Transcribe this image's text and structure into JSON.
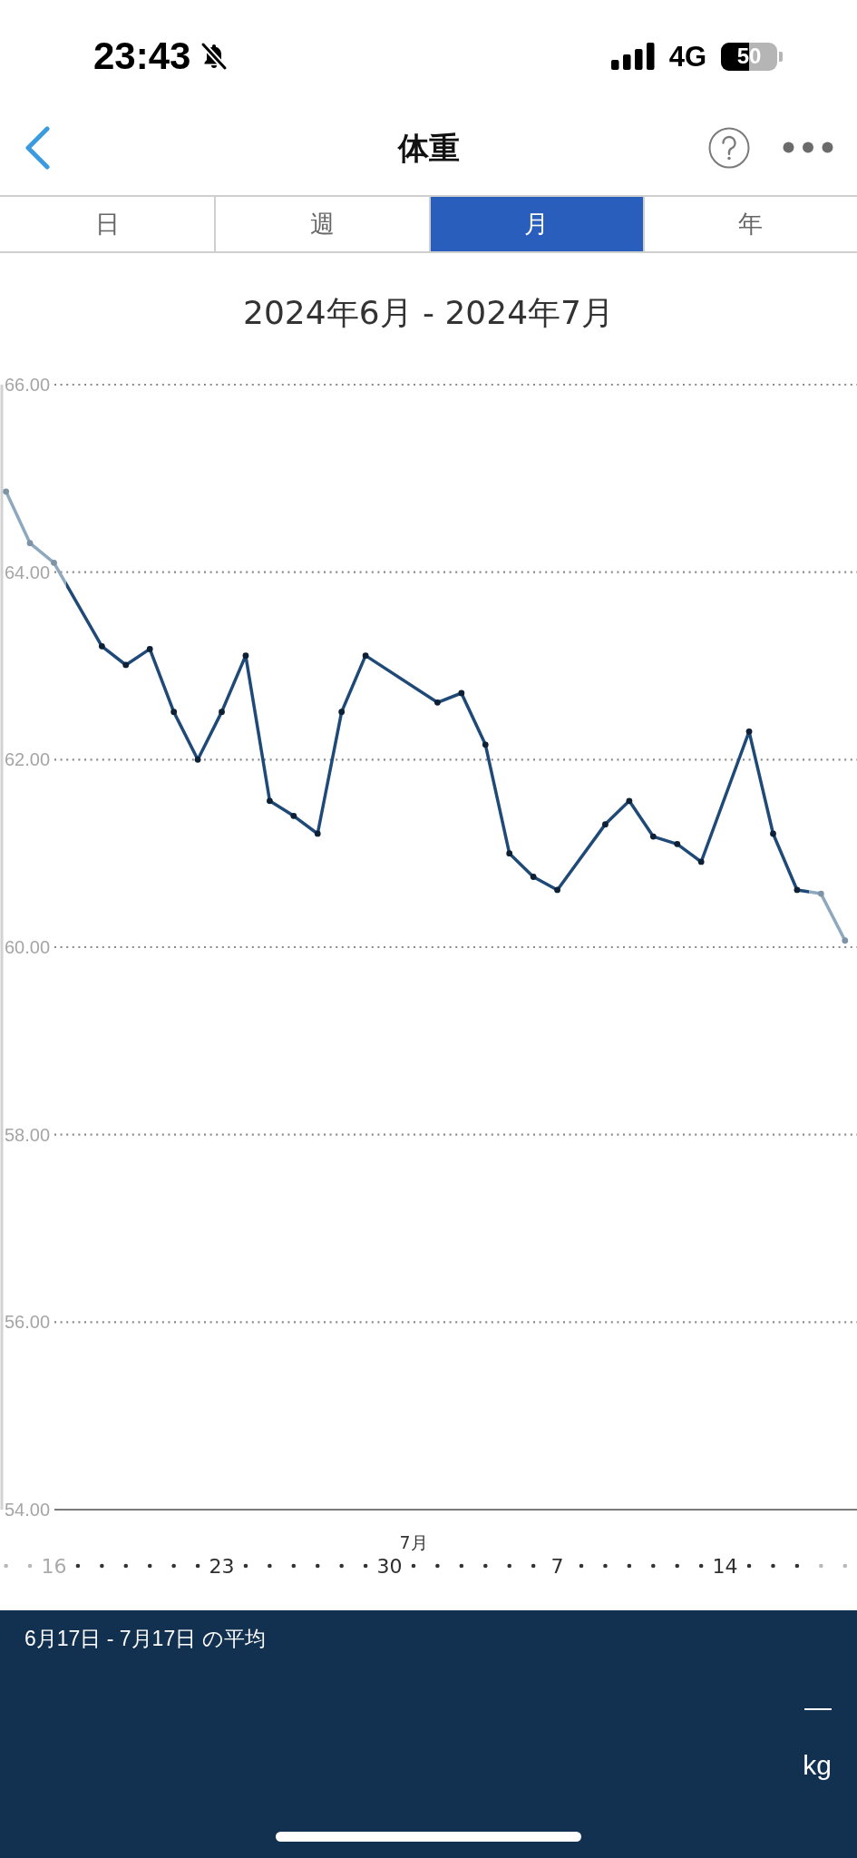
{
  "status_bar": {
    "time": "23:43",
    "network": "4G",
    "battery": "50"
  },
  "header": {
    "title": "体重"
  },
  "tabs": [
    {
      "label": "日",
      "selected": false
    },
    {
      "label": "週",
      "selected": false
    },
    {
      "label": "月",
      "selected": true
    },
    {
      "label": "年",
      "selected": false
    }
  ],
  "chart": {
    "title": "2024年6月 - 2024年7月",
    "month_labels": [
      {
        "label": "7月"
      }
    ],
    "axis_days": [
      {
        "in_period": false
      },
      {
        "in_period": false
      },
      {
        "in_period": false
      },
      {
        "in_period": true
      },
      {
        "in_period": true
      },
      {
        "in_period": true
      },
      {
        "in_period": true
      },
      {
        "in_period": true
      },
      {
        "in_period": true
      },
      {
        "in_period": true
      },
      {
        "in_period": true
      },
      {
        "in_period": true
      },
      {
        "in_period": true
      },
      {
        "in_period": true
      },
      {
        "in_period": true
      },
      {
        "in_period": true
      },
      {
        "in_period": true
      },
      {
        "in_period": true
      },
      {
        "in_period": true
      },
      {
        "in_period": true
      },
      {
        "in_period": true
      },
      {
        "in_period": true
      },
      {
        "in_period": true
      },
      {
        "in_period": true
      },
      {
        "in_period": true
      },
      {
        "in_period": true
      },
      {
        "in_period": true
      },
      {
        "in_period": true
      },
      {
        "in_period": true
      },
      {
        "in_period": true
      },
      {
        "in_period": true
      },
      {
        "in_period": true
      },
      {
        "in_period": true
      },
      {
        "in_period": true
      },
      {
        "in_period": false
      },
      {
        "in_period": false
      }
    ],
    "chart_data": {
      "type": "line",
      "grid": true,
      "x": [
        "2024-06-14",
        "2024-06-15",
        "2024-06-16",
        "2024-06-18",
        "2024-06-19",
        "2024-06-20",
        "2024-06-21",
        "2024-06-22",
        "2024-06-23",
        "2024-06-24",
        "2024-06-25",
        "2024-06-26",
        "2024-06-27",
        "2024-06-28",
        "2024-06-29",
        "2024-07-02",
        "2024-07-03",
        "2024-07-04",
        "2024-07-05",
        "2024-07-06",
        "2024-07-07",
        "2024-07-09",
        "2024-07-10",
        "2024-07-11",
        "2024-07-12",
        "2024-07-13",
        "2024-07-15",
        "2024-07-16",
        "2024-07-17",
        "2024-07-18",
        "2024-07-19"
      ],
      "series": [
        {
          "color": "#1f4a78",
          "marker": true,
          "values": [
            64.86,
            64.31,
            64.1,
            63.21,
            63.01,
            63.18,
            62.51,
            62.0,
            62.51,
            63.11,
            61.56,
            61.4,
            61.21,
            62.51,
            63.11,
            62.61,
            62.71,
            62.16,
            61.0,
            60.75,
            60.61,
            61.31,
            61.56,
            61.18,
            61.1,
            60.91,
            62.3,
            61.21,
            60.61,
            60.57,
            60.07
          ]
        }
      ],
      "xlim": [
        "2024-06-13T18:00",
        "2024-07-19T12:00"
      ],
      "ylim": [
        54,
        66
      ],
      "xticks": [
        {
          "value": "2024-06-16",
          "label": "16"
        },
        {
          "value": "2024-06-23",
          "label": "23"
        },
        {
          "value": "2024-06-30",
          "label": "30"
        },
        {
          "value": "2024-07-07",
          "label": "7"
        },
        {
          "value": "2024-07-14",
          "label": "14"
        }
      ],
      "yticks": [
        {
          "value": 54,
          "label": "54.00"
        },
        {
          "value": 56,
          "label": "56.00"
        },
        {
          "value": 58,
          "label": "58.00"
        },
        {
          "value": 60,
          "label": "60.00"
        },
        {
          "value": 62,
          "label": "62.00"
        },
        {
          "value": 64,
          "label": "64.00"
        },
        {
          "value": 66,
          "label": "66.00"
        }
      ]
    }
  },
  "summary": {
    "caption": "6月17日 - 7月17日 の平均",
    "value": "—",
    "unit": "kg"
  }
}
